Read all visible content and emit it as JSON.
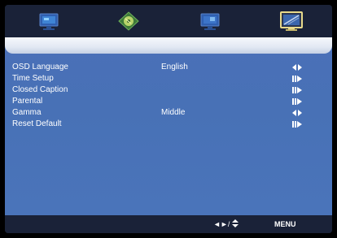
{
  "tabs": [
    {
      "icon": "picture-tv-icon"
    },
    {
      "icon": "audio-disc-icon"
    },
    {
      "icon": "channel-tv-icon"
    },
    {
      "icon": "setup-monitor-icon",
      "selected": true
    }
  ],
  "menu": {
    "items": [
      {
        "label": "OSD Language",
        "value": "English",
        "hint": "left-right-arrows-icon"
      },
      {
        "label": "Time Setup",
        "value": "",
        "hint": "enter-arrow-icon"
      },
      {
        "label": "Closed Caption",
        "value": "",
        "hint": "enter-arrow-icon"
      },
      {
        "label": "Parental",
        "value": "",
        "hint": "enter-arrow-icon"
      },
      {
        "label": "Gamma",
        "value": "Middle",
        "hint": "left-right-arrows-icon"
      },
      {
        "label": "Reset Default",
        "value": "",
        "hint": "enter-arrow-icon"
      }
    ]
  },
  "footer": {
    "nav_hint": "◄►/",
    "menu_label": "MENU"
  },
  "colors": {
    "panel_blue": "#4a70b8",
    "bar_dark": "#1a2238",
    "highlight_gold": "#e8d98a"
  }
}
